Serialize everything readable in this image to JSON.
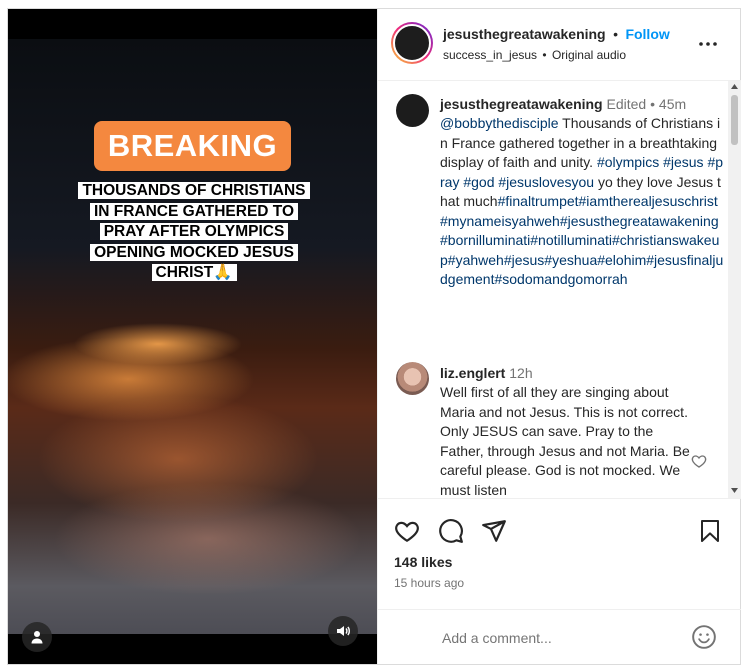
{
  "media": {
    "badge": "BREAKING",
    "headline": "THOUSANDS OF CHRISTIANS IN FRANCE GATHERED TO PRAY AFTER OLYMPICS OPENING MOCKED JESUS CHRIST🙏"
  },
  "header": {
    "username": "jesusthegreatawakening",
    "separator": "•",
    "follow_label": "Follow",
    "sub_user": "success_in_jesus",
    "sub_sep": "•",
    "audio": "Original audio"
  },
  "caption": {
    "username": "jesusthegreatawakening",
    "edited": "Edited",
    "sep": "•",
    "time": "45m",
    "mention": "@bobbythedisciple",
    "text1": " Thousands of Christians in France gathered together in a breathtaking display of faith and unity. ",
    "tags1": "#olympics #jesus #pray #god #jesuslovesyou",
    "text2": " yo they love Jesus that much",
    "tags2": "#finaltrumpet#iamtherealjesuschrist#mynameisyahweh#jesusthegreatawakening#bornilluminati#notilluminati#christianswakeup#yahweh#jesus#yeshua#elohim#jesusfinaljudgement#sodomandgomorrah"
  },
  "comment": {
    "username": "liz.englert",
    "time": "12h",
    "text": "Well first of all they are singing about Maria and not Jesus. This is not correct. Only JESUS can save. Pray to the Father, through Jesus and not Maria. Be careful please. God is not mocked. We must listen"
  },
  "stats": {
    "likes": "148 likes",
    "posted": "15 hours ago"
  },
  "add_comment": {
    "placeholder": "Add a comment..."
  },
  "icons": {
    "more": "more-horizontal-icon",
    "like": "heart-icon",
    "comment": "comment-icon",
    "share": "send-icon",
    "save": "bookmark-icon",
    "emoji": "emoji-icon"
  }
}
